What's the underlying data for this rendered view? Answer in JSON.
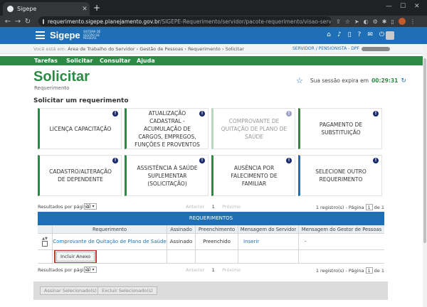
{
  "browser": {
    "tab_title": "Sigepe",
    "url_domain": "requerimento.sigepe.planejamento.gov.br",
    "url_path": "/SIGEPE-Requerimento/servidor/pacote-requerimento/visao-servidor-solicitar.jsf?..."
  },
  "header": {
    "logo": "Sigepe",
    "logo_subtitle": "SISTEMA DE GESTÃO DE PESSOAS"
  },
  "breadcrumb": {
    "prefix": "Você está em:",
    "path": "Área de Trabalho do Servidor › Gestão de Pessoas › Requerimento › Solicitar",
    "profile": "SERVIDOR / PENSIONISTA - DPF"
  },
  "menu": [
    "Tarefas",
    "Solicitar",
    "Consultar",
    "Ajuda"
  ],
  "page": {
    "title": "Solicitar",
    "subtitle": "Requerimento",
    "session_label": "Sua sessão expira em",
    "session_timer": "00:29:31",
    "section_title": "Solicitar um requerimento"
  },
  "cards": [
    "LICENÇA CAPACITAÇÃO",
    "ATUALIZAÇÃO CADASTRAL - ACUMULAÇÃO DE CARGOS, EMPREGOS, FUNÇÕES E PROVENTOS",
    "COMPROVANTE DE QUITAÇÃO DE PLANO DE SAÚDE",
    "PAGAMENTO DE SUBSTITUIÇÃO",
    "CADASTRO/ALTERAÇÃO DE DEPENDENTE",
    "ASSISTÊNCIA À SAÚDE SUPLEMENTAR (SOLICITAÇÃO)",
    "AUSÊNCIA POR FALECIMENTO DE FAMILIAR",
    "SELECIONE OUTRO REQUERIMENTO"
  ],
  "pager": {
    "per_page_label": "Resultados por página:",
    "per_page_value": "20",
    "prev": "Anterior",
    "current": "1",
    "next": "Próximo",
    "records": "1 registro(s) - Página",
    "page_box": "1",
    "of": "de 1"
  },
  "table": {
    "title": "REQUERIMENTOS",
    "columns": [
      "",
      "Requerimento",
      "Assinado",
      "Preenchimento",
      "Mensagem do Servidor",
      "Mensagem do Gestor de Pessoas"
    ],
    "row": {
      "requerimento": "Comprovante de Quitação de Plano de Saúde",
      "assinado": "Assinado",
      "preenchimento": "Preenchido",
      "mensagem_servidor": "Inserir",
      "mensagem_gestor": "-"
    },
    "incluir_anexo": "Incluir Anexo"
  },
  "actions": {
    "assinar": "Assinar Selecionado(s)",
    "excluir": "Excluir Selecionado(s)"
  }
}
